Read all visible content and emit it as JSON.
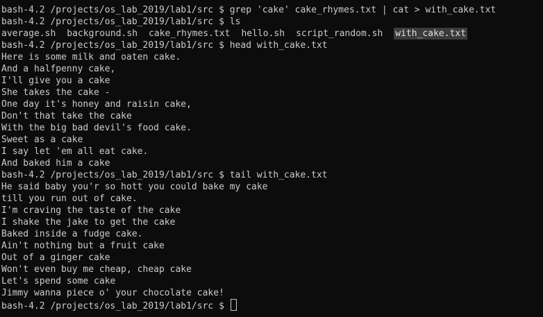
{
  "terminal": {
    "prompt": "bash-4.2 /projects/os_lab_2019/lab1/src $ ",
    "commands": {
      "grep": "grep 'cake' cake_rhymes.txt | cat > with_cake.txt",
      "ls": "ls",
      "head": "head with_cake.txt",
      "tail": "tail with_cake.txt"
    },
    "ls_output": [
      "average.sh",
      "background.sh",
      "cake_rhymes.txt",
      "hello.sh",
      "script_random.sh",
      "with_cake.txt"
    ],
    "head_output": [
      "Here is some milk and oaten cake.",
      "And a halfpenny cake,",
      "I'll give you a cake",
      "She takes the cake -",
      "One day it's honey and raisin cake,",
      "Don't that take the cake",
      "With the big bad devil's food cake.",
      "Sweet as a cake",
      "I say let 'em all eat cake.",
      "And baked him a cake"
    ],
    "tail_output": [
      "He said baby you'r so hott you could bake my cake",
      "till you run out of cake.",
      "I'm craving the taste of the cake",
      "I shake the jake to get the cake",
      "Baked inside a fudge cake.",
      "Ain't nothing but a fruit cake",
      "Out of a ginger cake",
      "Won't even buy me cheap, cheap cake",
      "Let's spend some cake",
      "Jimmy wanna piece o' your chocolate cake!"
    ]
  }
}
